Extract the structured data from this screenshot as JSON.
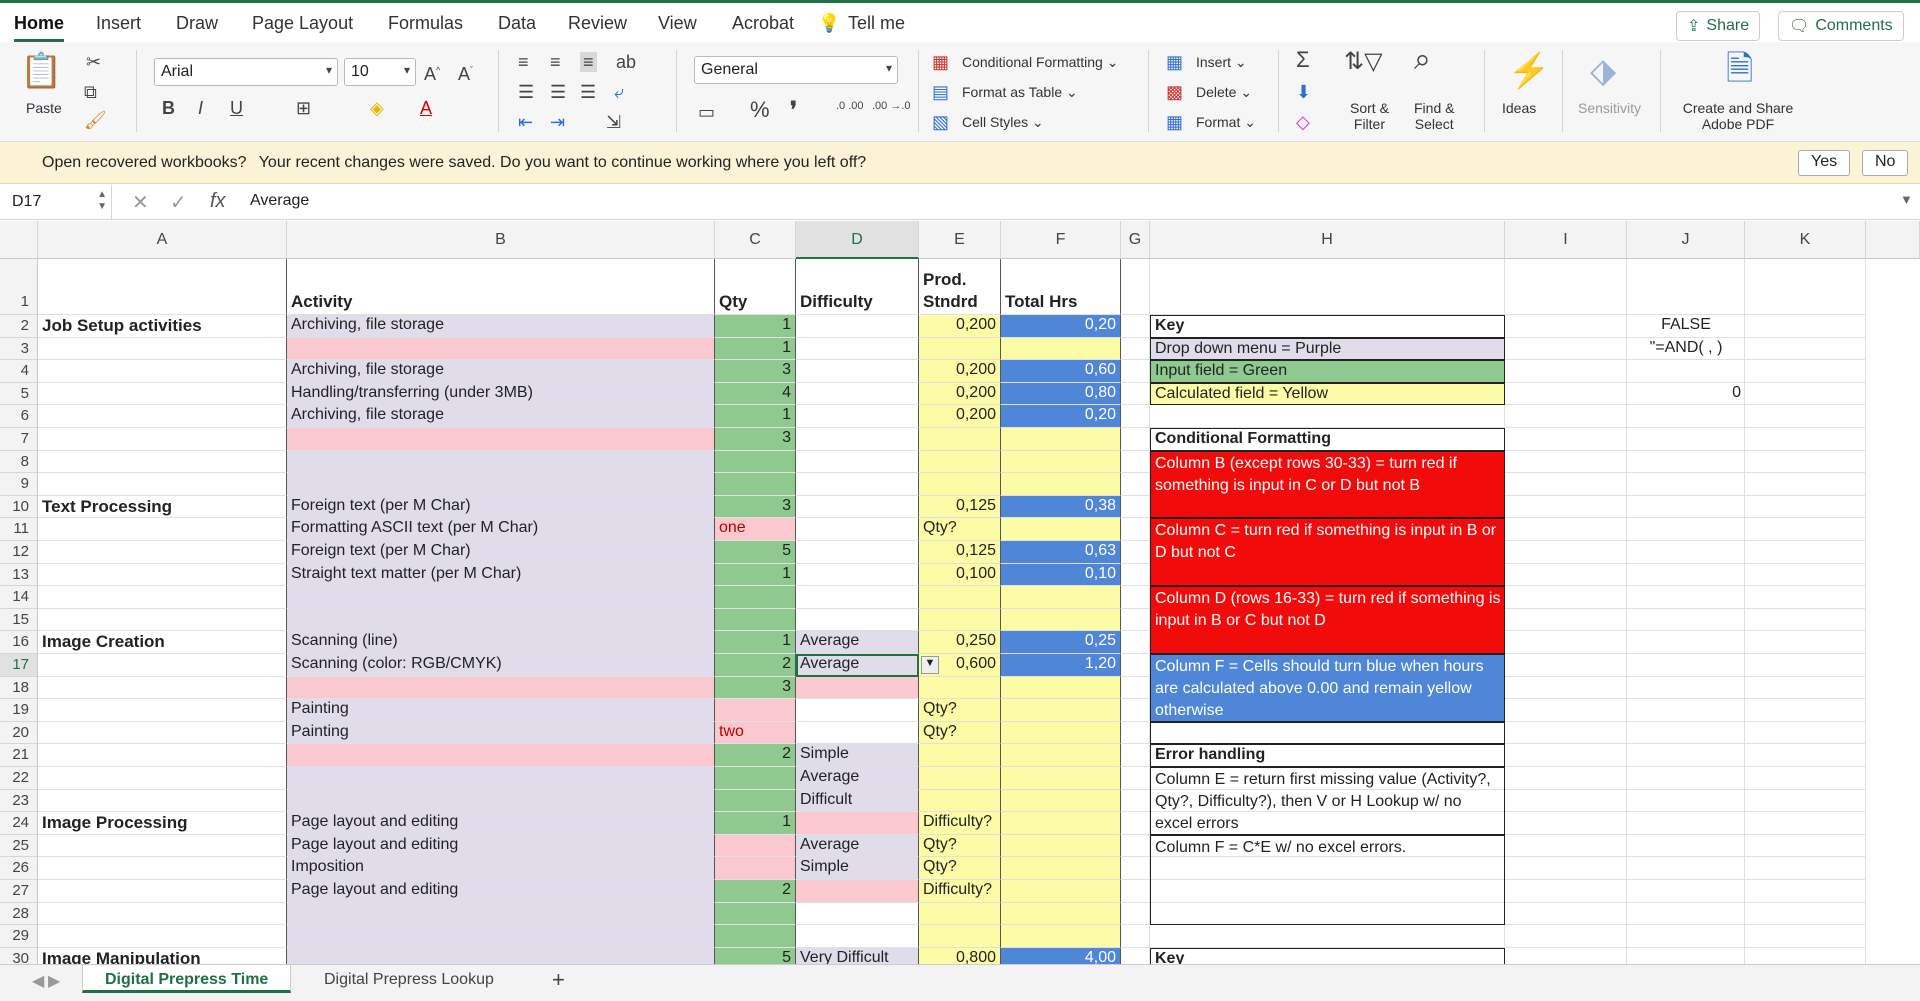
{
  "ribbon_tabs": [
    "Home",
    "Insert",
    "Draw",
    "Page Layout",
    "Formulas",
    "Data",
    "Review",
    "View",
    "Acrobat",
    "Tell me"
  ],
  "topbar": {
    "share": "Share",
    "comments": "Comments"
  },
  "ribbon": {
    "paste": "Paste",
    "font_name": "Arial",
    "font_size": "10",
    "number_format": "General",
    "conditional_formatting": "Conditional Formatting",
    "format_as_table": "Format as Table",
    "cell_styles": "Cell Styles",
    "insert": "Insert",
    "delete": "Delete",
    "format": "Format",
    "sort_filter": "Sort &\nFilter",
    "find_select": "Find &\nSelect",
    "ideas": "Ideas",
    "sensitivity": "Sensitivity",
    "adobe_pdf": "Create and Share\nAdobe PDF",
    "bold": "B",
    "italic": "I",
    "underline": "U",
    "percent": "%",
    "comma": "❜",
    "inc_decimal": ".0\n.00",
    "dec_decimal": ".00\n→.0"
  },
  "message_bar": {
    "title": "Open recovered workbooks?",
    "text": "Your recent changes were saved. Do you want to continue working where you left off?",
    "yes": "Yes",
    "no": "No"
  },
  "formula_bar": {
    "name_box": "D17",
    "formula": "Average"
  },
  "columns": [
    "A",
    "B",
    "C",
    "D",
    "E",
    "F",
    "G",
    "H",
    "I",
    "J",
    "K"
  ],
  "rows": [
    "1",
    "2",
    "3",
    "4",
    "5",
    "6",
    "7",
    "8",
    "9",
    "10",
    "11",
    "12",
    "13",
    "14",
    "15",
    "16",
    "17",
    "18",
    "19",
    "20",
    "21",
    "22",
    "23",
    "24",
    "25",
    "26",
    "27",
    "28",
    "29",
    "30"
  ],
  "cells": {
    "B1": "Activity",
    "C1": "Qty",
    "D1": "Difficulty",
    "E1": "Prod.\nStndrd",
    "F1": "Total Hrs",
    "A2": "Job Setup activities",
    "B2": "Archiving, file storage",
    "C2": "1",
    "E2": "0,200",
    "F2": "0,20",
    "C3": "1",
    "B4": "Archiving, file storage",
    "C4": "3",
    "E4": "0,200",
    "F4": "0,60",
    "B5": "Handling/transferring (under 3MB)",
    "C5": "4",
    "E5": "0,200",
    "F5": "0,80",
    "B6": "Archiving, file storage",
    "C6": "1",
    "E6": "0,200",
    "F6": "0,20",
    "C7": "3",
    "A10": "Text Processing",
    "B10": "Foreign text (per M Char)",
    "C10": "3",
    "E10": "0,125",
    "F10": "0,38",
    "B11": "Formatting ASCII text (per M Char)",
    "C11": "one",
    "E11": "Qty?",
    "B12": "Foreign text (per M Char)",
    "C12": "5",
    "E12": "0,125",
    "F12": "0,63",
    "B13": "Straight text matter (per M Char)",
    "C13": "1",
    "E13": "0,100",
    "F13": "0,10",
    "A16": "Image Creation",
    "B16": "Scanning (line)",
    "C16": "1",
    "D16": "Average",
    "E16": "0,250",
    "F16": "0,25",
    "B17": "Scanning (color: RGB/CMYK)",
    "C17": "2",
    "D17": "Average",
    "E17": "0,600",
    "F17": "1,20",
    "C18": "3",
    "B19": "Painting",
    "E19": "Qty?",
    "B20": "Painting",
    "C20": "two",
    "E20": "Qty?",
    "C21": "2",
    "D21": "Simple",
    "D22": "Average",
    "D23": "Difficult",
    "A24": "Image Processing",
    "B24": "Page layout and editing",
    "C24": "1",
    "E24": "Difficulty?",
    "B25": "Page layout and editing",
    "D25": "Average",
    "E25": "Qty?",
    "B26": "Imposition",
    "D26": "Simple",
    "E26": "Qty?",
    "B27": "Page layout and editing",
    "C27": "2",
    "E27": "Difficulty?",
    "A30": "Image Manipulation",
    "C30": "5",
    "D30": "Very Difficult",
    "E30": "0,800",
    "F30": "4,00",
    "J2": "FALSE",
    "J3": "\"=AND(      ,      )",
    "J5": "0"
  },
  "key_panel": {
    "key_title": "Key",
    "drop_down": "Drop down menu = Purple",
    "input_field": "Input field = Green",
    "calculated": "Calculated field = Yellow",
    "cf_title": "Conditional Formatting",
    "cf_b": "Column B (except rows 30-33) = turn red if something is input in C or D but not B",
    "cf_c": "Column C = turn red if something is input in B or D but not C",
    "cf_d": "Column D (rows 16-33) = turn red if something is input in B or C but not D",
    "cf_f": "Column F = Cells should turn blue when hours are calculated above 0.00 and remain yellow otherwise",
    "eh_title": "Error handling",
    "eh_e": "Column E = return first missing value (Activity?, Qty?, Difficulty?), then V or H Lookup w/ no excel errors",
    "eh_f": "Column F = C*E w/ no excel errors.",
    "key2_title": "Key"
  },
  "sheet_tabs": [
    "Digital Prepress Time",
    "Digital Prepress Lookup"
  ],
  "add_sheet": "+"
}
